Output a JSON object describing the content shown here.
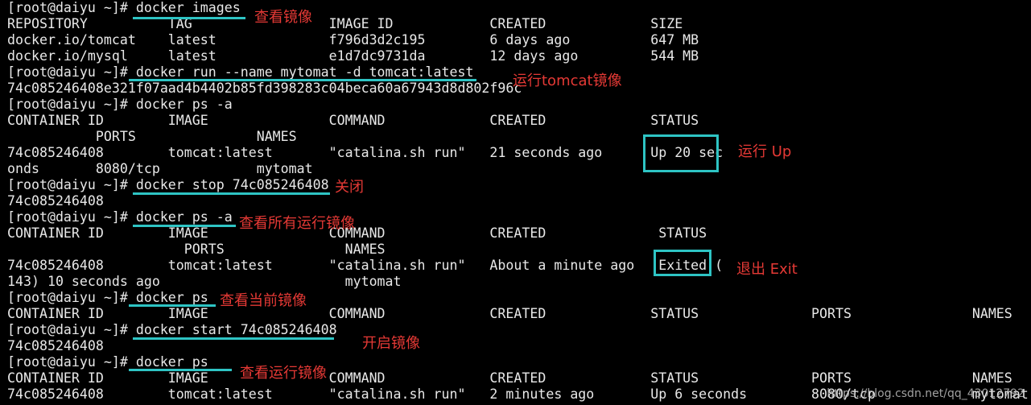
{
  "terminal": {
    "lines": [
      "[root@daiyu ~]# docker images",
      "REPOSITORY          TAG                 IMAGE ID            CREATED             SIZE",
      "docker.io/tomcat    latest              f796d3d2c195        6 days ago          647 MB",
      "docker.io/mysql     latest              e1d7dc9731da        12 days ago         544 MB",
      "[root@daiyu ~]# docker run --name mytomat -d tomcat:latest",
      "74c085246408e321f07aad4b4402b85fd398283c04beca60a67943d8d802f96c",
      "[root@daiyu ~]# docker ps -a",
      "CONTAINER ID        IMAGE               COMMAND             CREATED             STATUS",
      "           PORTS               NAMES",
      "74c085246408        tomcat:latest       \"catalina.sh run\"   21 seconds ago      Up 20 sec",
      "onds       8080/tcp            mytomat",
      "[root@daiyu ~]# docker stop 74c085246408",
      "74c085246408",
      "[root@daiyu ~]# docker ps -a",
      "CONTAINER ID        IMAGE               COMMAND             CREATED              STATUS",
      "                      PORTS               NAMES",
      "74c085246408        tomcat:latest       \"catalina.sh run\"   About a minute ago   Exited (",
      "143) 10 seconds ago                       mytomat",
      "[root@daiyu ~]# docker ps",
      "CONTAINER ID        IMAGE               COMMAND             CREATED             STATUS              PORTS               NAMES",
      "[root@daiyu ~]# docker start 74c085246408",
      "74c085246408",
      "[root@daiyu ~]# docker ps",
      "CONTAINER ID        IMAGE               COMMAND             CREATED             STATUS              PORTS               NAMES",
      "74c085246408        tomcat:latest       \"catalina.sh run\"   2 minutes ago       Up 6 seconds        8080/tcp            mytomat"
    ]
  },
  "annotations": {
    "view_images": "查看镜像",
    "run_tomcat": "运行tomcat镜像",
    "running_up": "运行 Up",
    "stop": "关闭",
    "view_all": "查看所有运行镜像",
    "exit": "退出 Exit",
    "view_current": "查看当前镜像",
    "start": "开启镜像",
    "view_running": "查看运行镜像"
  },
  "watermark": "https://blog.csdn.net/qq_43012792",
  "colors": {
    "highlight": "#2ec4c4",
    "note": "#e53935",
    "background": "#000000",
    "text": "#e8e8e8"
  }
}
